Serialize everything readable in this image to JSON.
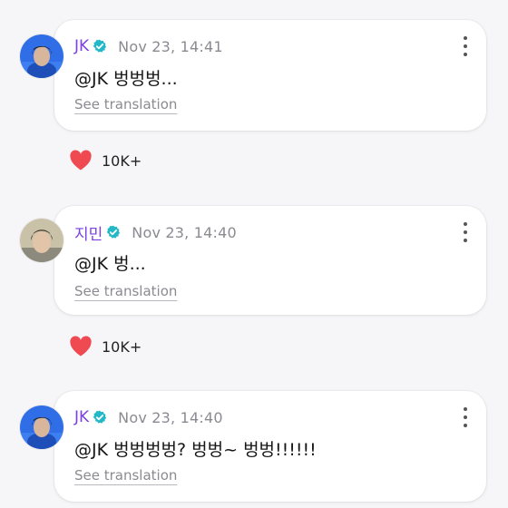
{
  "colors": {
    "accent_name": "#7b3fe4",
    "verified_badge": "#22b8c8",
    "heart": "#ef4a52"
  },
  "icons": {
    "verified": "verified-check-icon",
    "more": "more-vertical-icon",
    "heart": "heart-icon"
  },
  "posts": [
    {
      "author": "JK",
      "timestamp": "Nov 23, 14:41",
      "text": "@JK 벙벙벙...",
      "translate_label": "See translation",
      "likes": "10K+"
    },
    {
      "author": "지민",
      "timestamp": "Nov 23, 14:40",
      "text": "@JK 벙...",
      "translate_label": "See translation",
      "likes": "10K+"
    },
    {
      "author": "JK",
      "timestamp": "Nov 23, 14:40",
      "text": "@JK 벙벙벙벙? 벙벙~ 벙벙!!!!!!",
      "translate_label": "See translation"
    }
  ]
}
